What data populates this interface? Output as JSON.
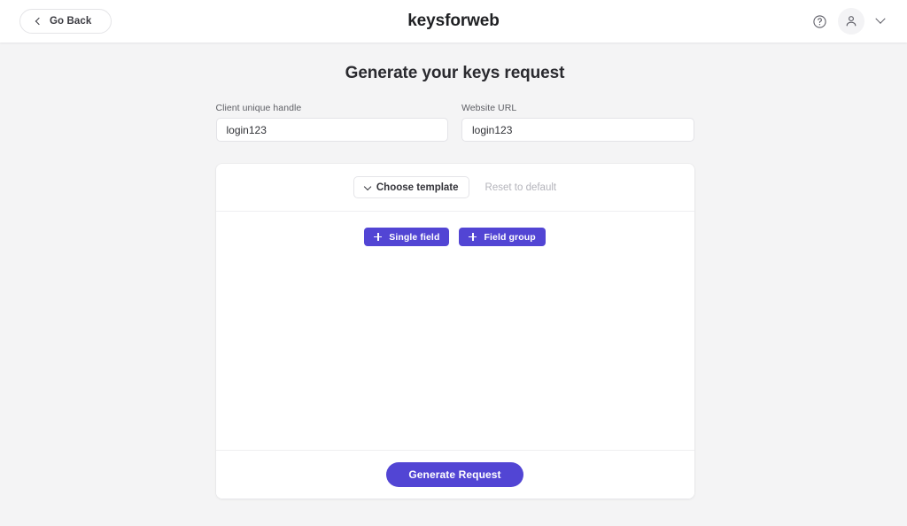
{
  "header": {
    "back_button": {
      "label": "Go Back",
      "icon": "chevron-left-icon"
    },
    "title": "keysforweb",
    "help_icon": "help-circle-icon",
    "avatar_icon": "user-icon",
    "menu_chevron_icon": "chevron-down-icon"
  },
  "main": {
    "page_title": "Generate your keys request",
    "fields": [
      {
        "label": "Client unique handle",
        "value": "login123",
        "placeholder": "Client unique handle"
      },
      {
        "label": "Website URL",
        "value": "login123",
        "placeholder": "Website URL"
      }
    ],
    "builder": {
      "toolbar": {
        "choose_template_label": "Choose template",
        "choose_template_icon": "chevron-down-icon",
        "reset_label": "Reset to default"
      },
      "add_buttons": [
        {
          "label": "Single field",
          "icon": "plus-icon"
        },
        {
          "label": "Field group",
          "icon": "plus-icon"
        }
      ],
      "canvas_items": [],
      "submit_label": "Generate Request"
    }
  },
  "colors": {
    "accent": "#5245d4",
    "page_background": "#f4f4f5",
    "card_background": "#ffffff",
    "muted_text": "#b4b4bb",
    "border": "#e4e4e8"
  }
}
